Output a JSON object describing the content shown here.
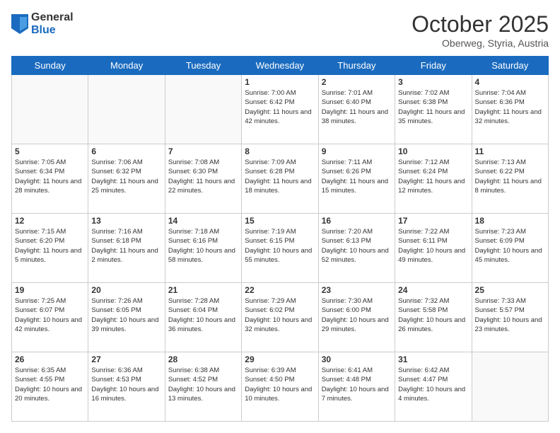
{
  "logo": {
    "general": "General",
    "blue": "Blue"
  },
  "header": {
    "month": "October 2025",
    "location": "Oberweg, Styria, Austria"
  },
  "weekdays": [
    "Sunday",
    "Monday",
    "Tuesday",
    "Wednesday",
    "Thursday",
    "Friday",
    "Saturday"
  ],
  "weeks": [
    [
      {
        "day": "",
        "info": ""
      },
      {
        "day": "",
        "info": ""
      },
      {
        "day": "",
        "info": ""
      },
      {
        "day": "1",
        "info": "Sunrise: 7:00 AM\nSunset: 6:42 PM\nDaylight: 11 hours and 42 minutes."
      },
      {
        "day": "2",
        "info": "Sunrise: 7:01 AM\nSunset: 6:40 PM\nDaylight: 11 hours and 38 minutes."
      },
      {
        "day": "3",
        "info": "Sunrise: 7:02 AM\nSunset: 6:38 PM\nDaylight: 11 hours and 35 minutes."
      },
      {
        "day": "4",
        "info": "Sunrise: 7:04 AM\nSunset: 6:36 PM\nDaylight: 11 hours and 32 minutes."
      }
    ],
    [
      {
        "day": "5",
        "info": "Sunrise: 7:05 AM\nSunset: 6:34 PM\nDaylight: 11 hours and 28 minutes."
      },
      {
        "day": "6",
        "info": "Sunrise: 7:06 AM\nSunset: 6:32 PM\nDaylight: 11 hours and 25 minutes."
      },
      {
        "day": "7",
        "info": "Sunrise: 7:08 AM\nSunset: 6:30 PM\nDaylight: 11 hours and 22 minutes."
      },
      {
        "day": "8",
        "info": "Sunrise: 7:09 AM\nSunset: 6:28 PM\nDaylight: 11 hours and 18 minutes."
      },
      {
        "day": "9",
        "info": "Sunrise: 7:11 AM\nSunset: 6:26 PM\nDaylight: 11 hours and 15 minutes."
      },
      {
        "day": "10",
        "info": "Sunrise: 7:12 AM\nSunset: 6:24 PM\nDaylight: 11 hours and 12 minutes."
      },
      {
        "day": "11",
        "info": "Sunrise: 7:13 AM\nSunset: 6:22 PM\nDaylight: 11 hours and 8 minutes."
      }
    ],
    [
      {
        "day": "12",
        "info": "Sunrise: 7:15 AM\nSunset: 6:20 PM\nDaylight: 11 hours and 5 minutes."
      },
      {
        "day": "13",
        "info": "Sunrise: 7:16 AM\nSunset: 6:18 PM\nDaylight: 11 hours and 2 minutes."
      },
      {
        "day": "14",
        "info": "Sunrise: 7:18 AM\nSunset: 6:16 PM\nDaylight: 10 hours and 58 minutes."
      },
      {
        "day": "15",
        "info": "Sunrise: 7:19 AM\nSunset: 6:15 PM\nDaylight: 10 hours and 55 minutes."
      },
      {
        "day": "16",
        "info": "Sunrise: 7:20 AM\nSunset: 6:13 PM\nDaylight: 10 hours and 52 minutes."
      },
      {
        "day": "17",
        "info": "Sunrise: 7:22 AM\nSunset: 6:11 PM\nDaylight: 10 hours and 49 minutes."
      },
      {
        "day": "18",
        "info": "Sunrise: 7:23 AM\nSunset: 6:09 PM\nDaylight: 10 hours and 45 minutes."
      }
    ],
    [
      {
        "day": "19",
        "info": "Sunrise: 7:25 AM\nSunset: 6:07 PM\nDaylight: 10 hours and 42 minutes."
      },
      {
        "day": "20",
        "info": "Sunrise: 7:26 AM\nSunset: 6:05 PM\nDaylight: 10 hours and 39 minutes."
      },
      {
        "day": "21",
        "info": "Sunrise: 7:28 AM\nSunset: 6:04 PM\nDaylight: 10 hours and 36 minutes."
      },
      {
        "day": "22",
        "info": "Sunrise: 7:29 AM\nSunset: 6:02 PM\nDaylight: 10 hours and 32 minutes."
      },
      {
        "day": "23",
        "info": "Sunrise: 7:30 AM\nSunset: 6:00 PM\nDaylight: 10 hours and 29 minutes."
      },
      {
        "day": "24",
        "info": "Sunrise: 7:32 AM\nSunset: 5:58 PM\nDaylight: 10 hours and 26 minutes."
      },
      {
        "day": "25",
        "info": "Sunrise: 7:33 AM\nSunset: 5:57 PM\nDaylight: 10 hours and 23 minutes."
      }
    ],
    [
      {
        "day": "26",
        "info": "Sunrise: 6:35 AM\nSunset: 4:55 PM\nDaylight: 10 hours and 20 minutes."
      },
      {
        "day": "27",
        "info": "Sunrise: 6:36 AM\nSunset: 4:53 PM\nDaylight: 10 hours and 16 minutes."
      },
      {
        "day": "28",
        "info": "Sunrise: 6:38 AM\nSunset: 4:52 PM\nDaylight: 10 hours and 13 minutes."
      },
      {
        "day": "29",
        "info": "Sunrise: 6:39 AM\nSunset: 4:50 PM\nDaylight: 10 hours and 10 minutes."
      },
      {
        "day": "30",
        "info": "Sunrise: 6:41 AM\nSunset: 4:48 PM\nDaylight: 10 hours and 7 minutes."
      },
      {
        "day": "31",
        "info": "Sunrise: 6:42 AM\nSunset: 4:47 PM\nDaylight: 10 hours and 4 minutes."
      },
      {
        "day": "",
        "info": ""
      }
    ]
  ]
}
